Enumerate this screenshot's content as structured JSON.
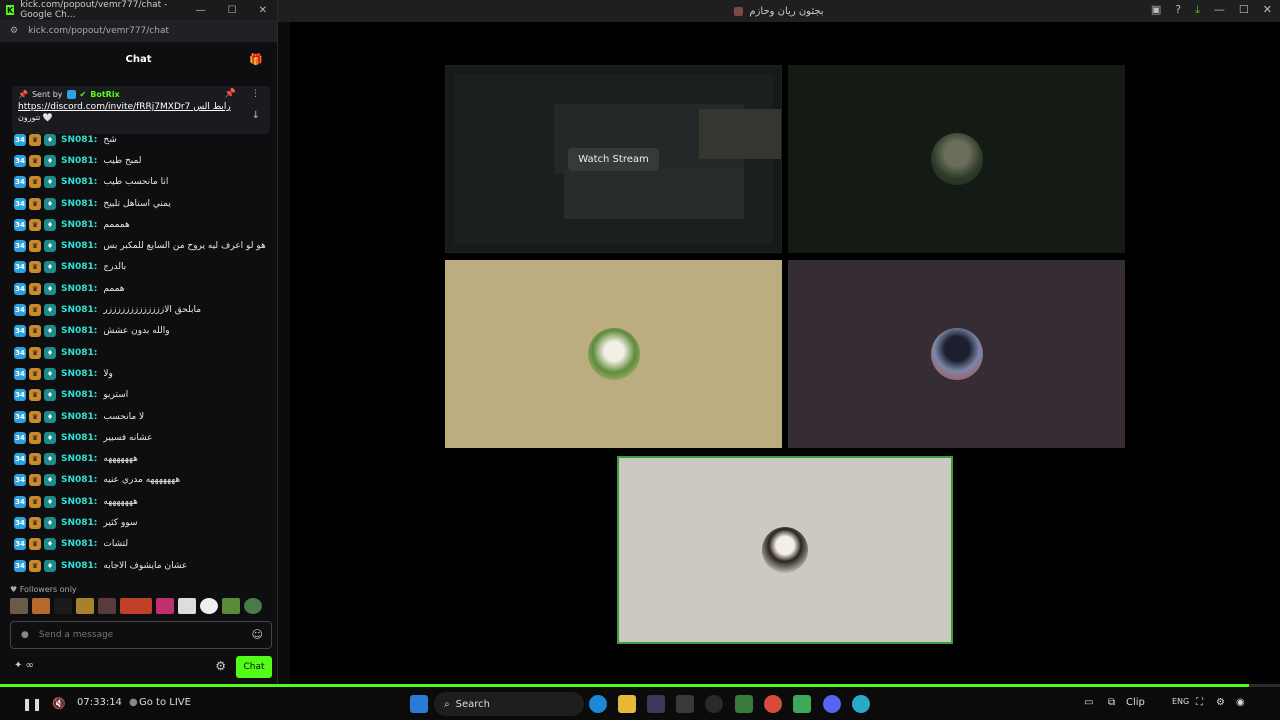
{
  "main_window": {
    "title": "بجثون ريان وحازم"
  },
  "chat_window": {
    "title": "kick.com/popout/vemr777/chat - Google Ch...",
    "url": "kick.com/popout/vemr777/chat",
    "header": "Chat",
    "pinned": {
      "sent_by": "Sent by",
      "bot_name": "BotRix",
      "link": "https://discord.com/invite/fRRj7MXDr7",
      "link_suffix": "رابط الس",
      "second_line": "تتورون 🤍"
    },
    "messages": [
      {
        "user": "SN081:",
        "text": "شح"
      },
      {
        "user": "SN081:",
        "text": "لمبح طيب"
      },
      {
        "user": "SN081:",
        "text": "انا مانحسب طيب"
      },
      {
        "user": "SN081:",
        "text": "يمني استاهل تلبيح"
      },
      {
        "user": "SN081:",
        "text": "همممم"
      },
      {
        "user": "SN081:",
        "text": "هو لو اعرف ليه يروح من السايع للمكبر بس"
      },
      {
        "user": "SN081:",
        "text": "بالدرج"
      },
      {
        "user": "SN081:",
        "text": "هممم"
      },
      {
        "user": "SN081:",
        "text": "مابلحق الازززززززززززززر"
      },
      {
        "user": "SN081:",
        "text": "والله بدون عشش"
      },
      {
        "user": "SN081:",
        "text": ""
      },
      {
        "user": "SN081:",
        "text": "ولا"
      },
      {
        "user": "SN081:",
        "text": "استريو"
      },
      {
        "user": "SN081:",
        "text": "لا مانحسب"
      },
      {
        "user": "SN081:",
        "text": "عشانه فسيير"
      },
      {
        "user": "SN081:",
        "text": "هههههههه"
      },
      {
        "user": "SN081:",
        "text": "هههههههه مدري عنيه"
      },
      {
        "user": "SN081:",
        "text": "هههههههه"
      },
      {
        "user": "SN081:",
        "text": "سوو كثير"
      },
      {
        "user": "SN081:",
        "text": "لتشات"
      },
      {
        "user": "SN081:",
        "text": "عشان مايشوف الاجابه"
      }
    ],
    "followers_only": "Followers only",
    "input_placeholder": "Send a message",
    "chat_button": "Chat"
  },
  "tiles": {
    "watch_stream": "Watch Stream"
  },
  "player": {
    "time": "07:33:14",
    "go_live": "Go to LIVE",
    "progress": 0.976
  },
  "taskbar": {
    "search": "Search",
    "clip": "Clip",
    "lang": "ENG"
  },
  "colors": {
    "accent": "#53fc18",
    "username": "#2fe2d2"
  }
}
